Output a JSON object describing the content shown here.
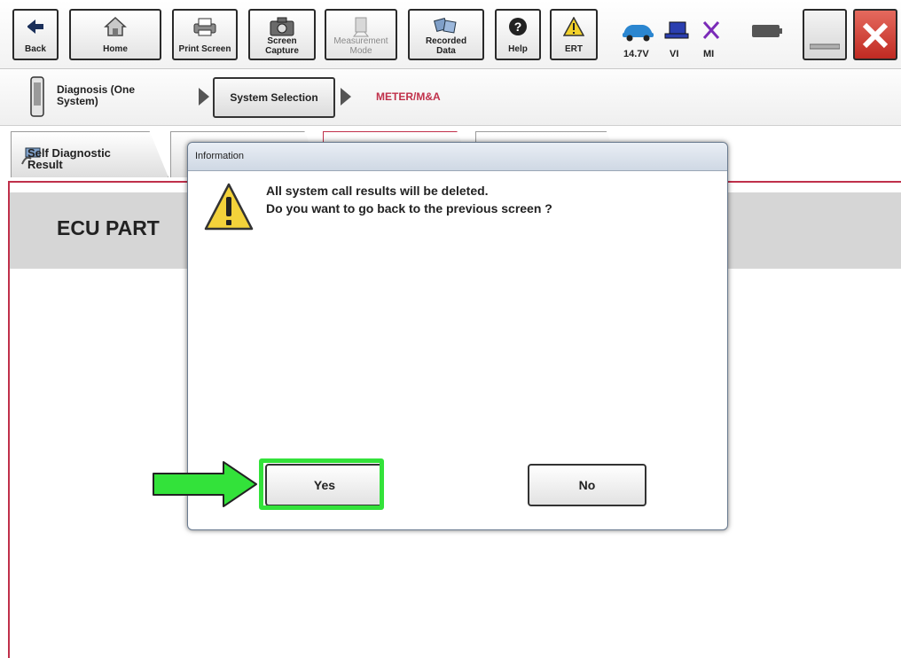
{
  "toolbar": {
    "back": "Back",
    "home": "Home",
    "print_screen": "Print Screen",
    "screen_capture": "Screen\nCapture",
    "measurement_mode": "Measurement\nMode",
    "recorded_data": "Recorded\nData",
    "help": "Help",
    "ert": "ERT",
    "voltage": "14.7V",
    "vi": "VI",
    "mi": "MI"
  },
  "breadcrumb": {
    "diagnosis": "Diagnosis (One\nSystem)",
    "system_selection": "System Selection",
    "current": "METER/M&A"
  },
  "tabs": {
    "self_diagnostic": "Self Diagnostic\nResult"
  },
  "content": {
    "title": "ECU PART"
  },
  "dialog": {
    "title": "Information",
    "message_line1": "All system call results will be deleted.",
    "message_line2": "Do you want to go back to the previous screen ?",
    "yes": "Yes",
    "no": "No"
  },
  "colors": {
    "accent_red": "#c0304a",
    "highlight_green": "#33e23a",
    "close_red": "#d03a2e"
  }
}
